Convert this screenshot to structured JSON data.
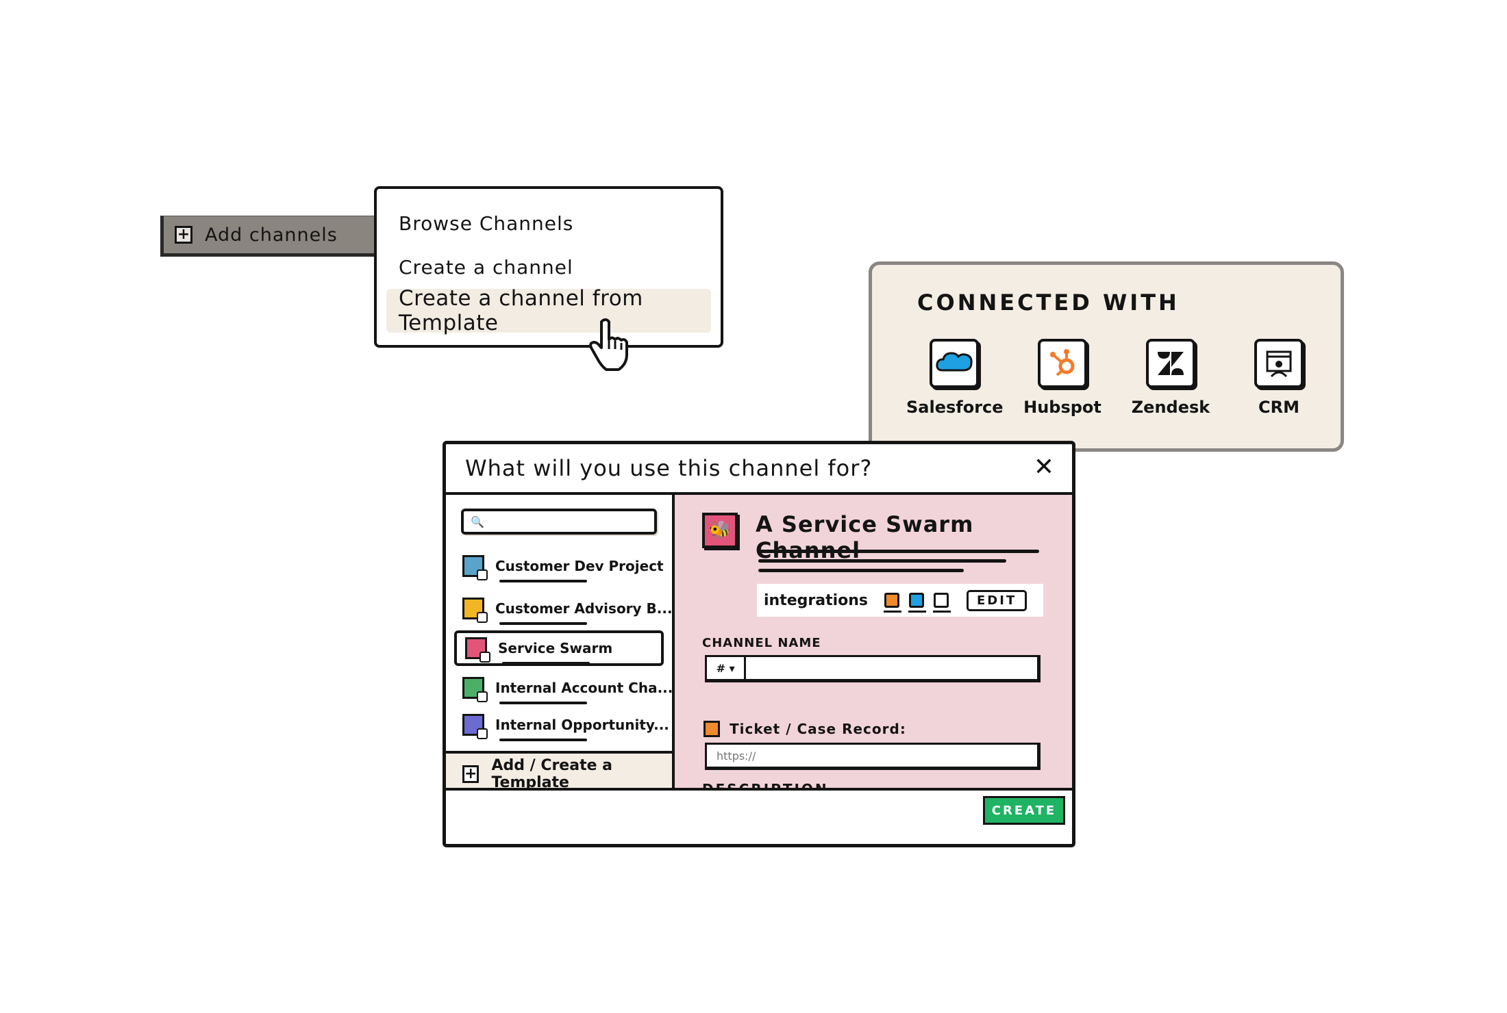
{
  "add_channels": {
    "label": "Add channels",
    "icon": "plus-icon"
  },
  "menu": {
    "items": [
      {
        "label": "Browse Channels"
      },
      {
        "label": "Create a channel"
      },
      {
        "label": "Create a channel from Template"
      }
    ]
  },
  "connected": {
    "title": "CONNECTED WITH",
    "integrations": [
      {
        "name": "Salesforce",
        "icon": "salesforce-icon",
        "color": "#1ea1e3"
      },
      {
        "name": "Hubspot",
        "icon": "hubspot-icon",
        "color": "#f47b2a"
      },
      {
        "name": "Zendesk",
        "icon": "zendesk-icon",
        "color": "#141414"
      },
      {
        "name": "CRM",
        "icon": "crm-icon",
        "color": "#141414"
      }
    ]
  },
  "dialog": {
    "title": "What will you use this channel for?",
    "close": "✕",
    "templates": [
      {
        "label": "Customer Dev Project",
        "color": "#5aa3c9"
      },
      {
        "label": "Customer Advisory B...",
        "color": "#f2b524"
      },
      {
        "label": "Service Swarm",
        "color": "#e2557a"
      },
      {
        "label": "Internal Account Cha...",
        "color": "#4caf68"
      },
      {
        "label": "Internal Opportunity...",
        "color": "#6d6bd1"
      }
    ],
    "add_template": "Add / Create a Template",
    "selected": {
      "title": "A Service Swarm Channel",
      "integrations_label": "integrations",
      "integration_colors": [
        "#f08b2c",
        "#1ea1e3",
        "#ffffff"
      ],
      "edit_label": "EDIT",
      "channel_name_label": "CHANNEL NAME",
      "channel_prefix": "# ▾",
      "ticket_label": "Ticket / Case Record:",
      "ticket_placeholder": "https://",
      "description_label": "DESCRIPTION"
    },
    "create_label": "CREATE"
  },
  "colors": {
    "panel_beige": "#f4ede4",
    "pink": "#f1d4da",
    "create_green": "#1fb364",
    "bar_gray": "#8b8580"
  }
}
